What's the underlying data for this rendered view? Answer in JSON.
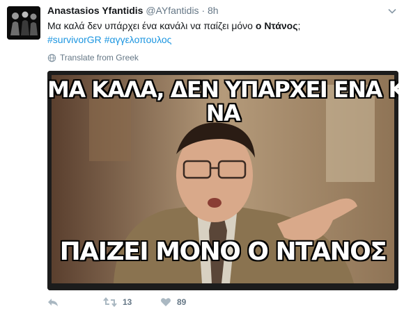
{
  "tweet": {
    "name": "Anastasios Yfantidis",
    "handle": "@AYfantidis",
    "separator": "·",
    "time": "8h",
    "text_plain": "Μα καλά δεν υπάρχει ένα κανάλι να παίζει μόνο ",
    "text_bold": "ο Ντάνος",
    "text_end": ";",
    "hashtags": [
      "#survivorGR",
      "#αγγελοπουλος"
    ],
    "translate": "Translate from Greek"
  },
  "meme": {
    "top_line_1": "ΜΑ ΚΑΛΑ, ΔΕΝ ΥΠΑΡΧΕΙ ΕΝΑ ΚΑΝΑΛΙ ΠΟΥ",
    "top_line_2": "ΝΑ",
    "bottom_line": "ΠΑΙΖΕΙ ΜΟΝΟ Ο ΝΤΑΝΟΣ"
  },
  "actions": {
    "retweets": "13",
    "likes": "89"
  },
  "colors": {
    "link": "#1b95e0",
    "muted": "#657786"
  }
}
